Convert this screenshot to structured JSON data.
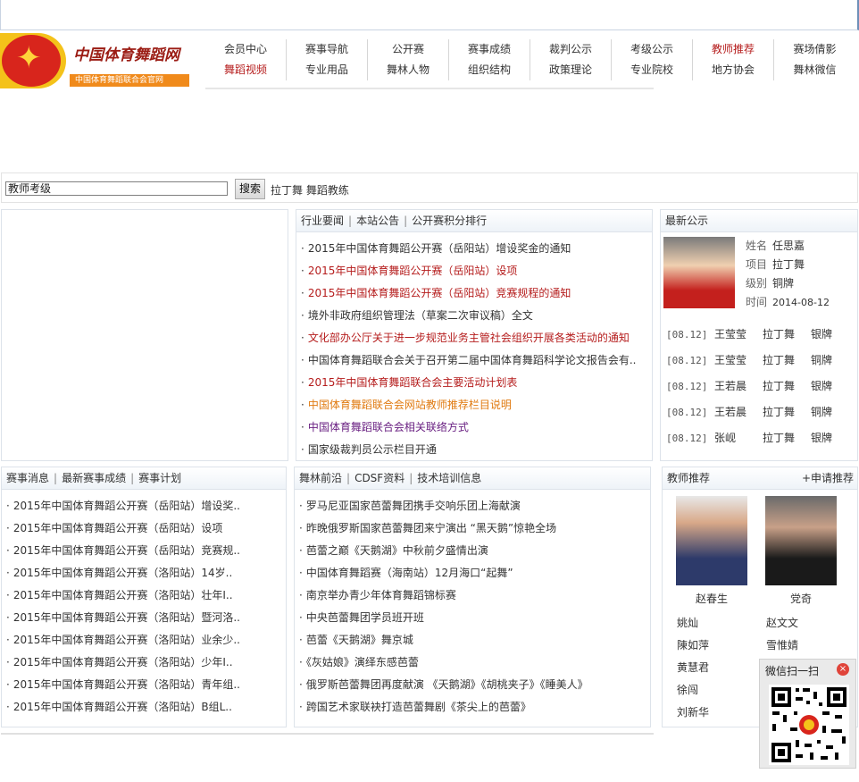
{
  "site": {
    "title": "中国体育舞蹈网",
    "subtitle": "中国体育舞蹈联合会官网"
  },
  "nav": {
    "row1": [
      "会员中心",
      "赛事导航",
      "公开赛",
      "赛事成绩",
      "裁判公示",
      "考级公示",
      "教师推荐",
      "赛场倩影"
    ],
    "row2": [
      "舞蹈视频",
      "专业用品",
      "舞林人物",
      "组织结构",
      "政策理论",
      "专业院校",
      "地方协会",
      "舞林微信"
    ]
  },
  "search": {
    "value": "教师考级",
    "button": "搜索",
    "keywords": "拉丁舞 舞蹈教练"
  },
  "news": {
    "tabs": [
      "行业要闻",
      "本站公告",
      "公开赛积分排行"
    ],
    "items": [
      {
        "text": "2015年中国体育舞蹈公开赛（岳阳站）增设奖金的通知",
        "color": "normal"
      },
      {
        "text": "2015年中国体育舞蹈公开赛（岳阳站）设项",
        "color": "red"
      },
      {
        "text": "2015年中国体育舞蹈公开赛（岳阳站）竞赛规程的通知",
        "color": "red"
      },
      {
        "text": "境外非政府组织管理法（草案二次审议稿）全文",
        "color": "normal"
      },
      {
        "text": "文化部办公厅关于进一步规范业务主管社会组织开展各类活动的通知",
        "color": "red"
      },
      {
        "text": "中国体育舞蹈联合会关于召开第二届中国体育舞蹈科学论文报告会有..",
        "color": "normal"
      },
      {
        "text": "2015年中国体育舞蹈联合会主要活动计划表",
        "color": "red"
      },
      {
        "text": "中国体育舞蹈联合会网站教师推荐栏目说明",
        "color": "orange"
      },
      {
        "text": "中国体育舞蹈联合会相关联络方式",
        "color": "purple"
      },
      {
        "text": "国家级裁判员公示栏目开通",
        "color": "normal"
      }
    ]
  },
  "latest": {
    "title": "最新公示",
    "person": {
      "name_label": "姓名",
      "name": "任思嘉",
      "item_label": "项目",
      "item": "拉丁舞",
      "level_label": "级别",
      "level": "铜牌",
      "time_label": "时间",
      "time": "2014-08-12"
    },
    "rows": [
      {
        "date": "[08.12]",
        "name": "王莹莹",
        "item": "拉丁舞",
        "medal": "银牌"
      },
      {
        "date": "[08.12]",
        "name": "王莹莹",
        "item": "拉丁舞",
        "medal": "铜牌"
      },
      {
        "date": "[08.12]",
        "name": "王若晨",
        "item": "拉丁舞",
        "medal": "银牌"
      },
      {
        "date": "[08.12]",
        "name": "王若晨",
        "item": "拉丁舞",
        "medal": "铜牌"
      },
      {
        "date": "[08.12]",
        "name": "张岘",
        "item": "拉丁舞",
        "medal": "银牌"
      }
    ]
  },
  "events": {
    "tabs": [
      "赛事消息",
      "最新赛事成绩",
      "赛事计划"
    ],
    "items": [
      "2015年中国体育舞蹈公开赛（岳阳站）增设奖..",
      "2015年中国体育舞蹈公开赛（岳阳站）设项",
      "2015年中国体育舞蹈公开赛（岳阳站）竞赛规..",
      "2015年中国体育舞蹈公开赛（洛阳站）14岁..",
      "2015年中国体育舞蹈公开赛（洛阳站）壮年I..",
      "2015年中国体育舞蹈公开赛（洛阳站）暨河洛..",
      "2015年中国体育舞蹈公开赛（洛阳站）业余少..",
      "2015年中国体育舞蹈公开赛（洛阳站）少年I..",
      "2015年中国体育舞蹈公开赛（洛阳站）青年组..",
      "2015年中国体育舞蹈公开赛（洛阳站）B组L.."
    ]
  },
  "dance": {
    "tabs": [
      "舞林前沿",
      "CDSF资料",
      "技术培训信息"
    ],
    "items": [
      "罗马尼亚国家芭蕾舞团携手交响乐团上海献演",
      "昨晚俄罗斯国家芭蕾舞团来宁演出 “黑天鹅”惊艳全场",
      "芭蕾之巅《天鹅湖》中秋前夕盛情出演",
      "中国体育舞蹈赛（海南站）12月海口“起舞”",
      "南京举办青少年体育舞蹈锦标赛",
      "中央芭蕾舞团学员班开班",
      "芭蕾《天鹅湖》舞京城",
      "《灰姑娘》演绎东感芭蕾",
      "俄罗斯芭蕾舞团再度献演 《天鹅湖》《胡桃夹子》《睡美人》",
      "跨国艺术家联袂打造芭蕾舞剧《茶尖上的芭蕾》"
    ]
  },
  "teachers": {
    "title": "教师推荐",
    "apply": "+申请推荐",
    "featured": [
      "赵春生",
      "党奇"
    ],
    "names": [
      [
        "姚灿",
        "赵文文"
      ],
      [
        "陳如萍",
        "雪惟婧"
      ],
      [
        "黄慧君",
        ""
      ],
      [
        "徐闯",
        ""
      ],
      [
        "刘新华",
        ""
      ]
    ]
  },
  "wechat": {
    "title": "微信扫一扫",
    "close": "×"
  }
}
